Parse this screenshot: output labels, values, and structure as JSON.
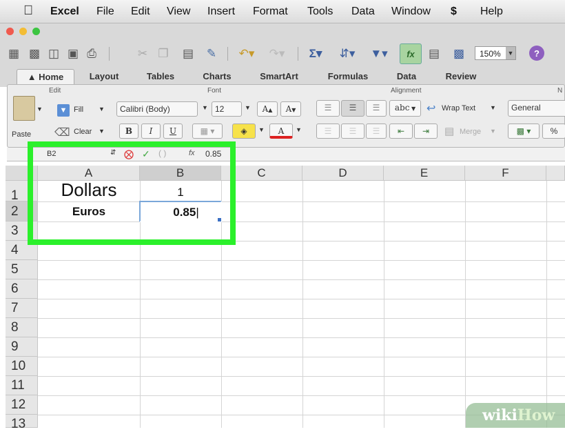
{
  "menubar": {
    "apple_icon": "apple-logo-icon",
    "app_name": "Excel",
    "items": [
      "File",
      "Edit",
      "View",
      "Insert",
      "Format",
      "Tools",
      "Data",
      "Window",
      "Help"
    ],
    "script_icon": "script-menu-icon"
  },
  "toolbar": {
    "zoom": "150%",
    "sum_glyph": "Σ",
    "help_glyph": "?"
  },
  "tabs": [
    {
      "label": "Home",
      "active": true
    },
    {
      "label": "Layout"
    },
    {
      "label": "Tables"
    },
    {
      "label": "Charts"
    },
    {
      "label": "SmartArt"
    },
    {
      "label": "Formulas"
    },
    {
      "label": "Data"
    },
    {
      "label": "Review"
    }
  ],
  "ribbon": {
    "group_edit": "Edit",
    "group_font": "Font",
    "group_alignment": "Alignment",
    "group_number": "N",
    "paste": "Paste",
    "fill": "Fill",
    "clear": "Clear",
    "font_name": "Calibri (Body)",
    "font_size": "12",
    "font_grow": "A",
    "font_shrink": "A",
    "bold": "B",
    "italic": "I",
    "underline": "U",
    "font_color": "A",
    "abc": "abc",
    "wrap_text": "Wrap Text",
    "merge": "Merge",
    "number_format": "General",
    "percent": "%"
  },
  "formula_bar": {
    "name_box": "B2",
    "fx": "fx",
    "value": "0.85"
  },
  "grid": {
    "columns": [
      "A",
      "B",
      "C",
      "D",
      "E",
      "F"
    ],
    "rows": [
      "1",
      "2",
      "3",
      "4",
      "5",
      "6",
      "7",
      "8",
      "9",
      "10",
      "11",
      "12",
      "13"
    ],
    "cells": {
      "A1": "Dollars",
      "B1": "1",
      "A2": "Euros",
      "B2": "0.85"
    },
    "active_cell": "B2"
  },
  "colors": {
    "highlight": "#2bf02b",
    "active_tab": "#f2f2f2",
    "ribbon": "#ececec"
  },
  "watermark": {
    "wiki": "wiki",
    "how": "How"
  }
}
